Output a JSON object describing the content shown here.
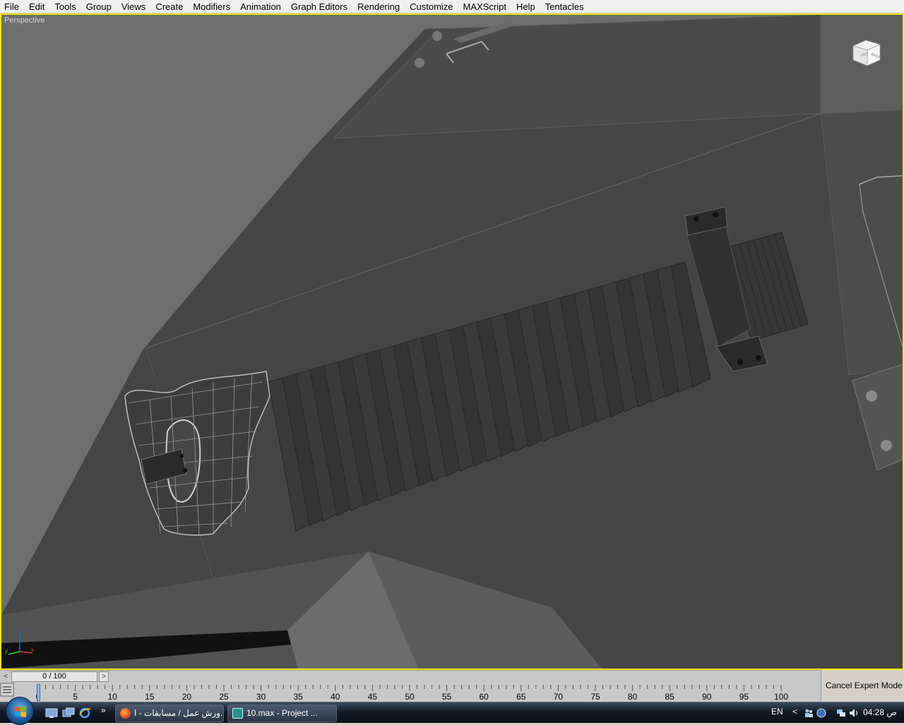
{
  "menubar": {
    "items": [
      "File",
      "Edit",
      "Tools",
      "Group",
      "Views",
      "Create",
      "Modifiers",
      "Animation",
      "Graph Editors",
      "Rendering",
      "Customize",
      "MAXScript",
      "Help",
      "Tentacles"
    ]
  },
  "viewport": {
    "label": "Perspective",
    "viewcube": {
      "face_left": "LEFT",
      "face_back": "BACK"
    },
    "axis": {
      "z": "z",
      "x": "x",
      "y": "y"
    },
    "border_color": "#f5e600"
  },
  "timeslider": {
    "prev": "<",
    "position": "0 / 100",
    "next": ">",
    "current_frame": 0,
    "total_frames": 100
  },
  "trackbar": {
    "ticks": [
      "0",
      "5",
      "10",
      "15",
      "20",
      "25",
      "30",
      "35",
      "40",
      "45",
      "50",
      "55",
      "60",
      "65",
      "70",
      "75",
      "80",
      "85",
      "90",
      "95",
      "100"
    ]
  },
  "expert": {
    "label": "Cancel Expert Mode"
  },
  "taskbar": {
    "quicklaunch_more": "»",
    "tasks": [
      {
        "label": "ورش عمل / مسابقات - ا...",
        "icon": "firefox-icon"
      },
      {
        "label": "10.max     - Project ...",
        "icon": "3dsmax-icon"
      }
    ],
    "tray": {
      "language": "EN",
      "arrow": "<",
      "clock": "04:28 ص"
    }
  }
}
